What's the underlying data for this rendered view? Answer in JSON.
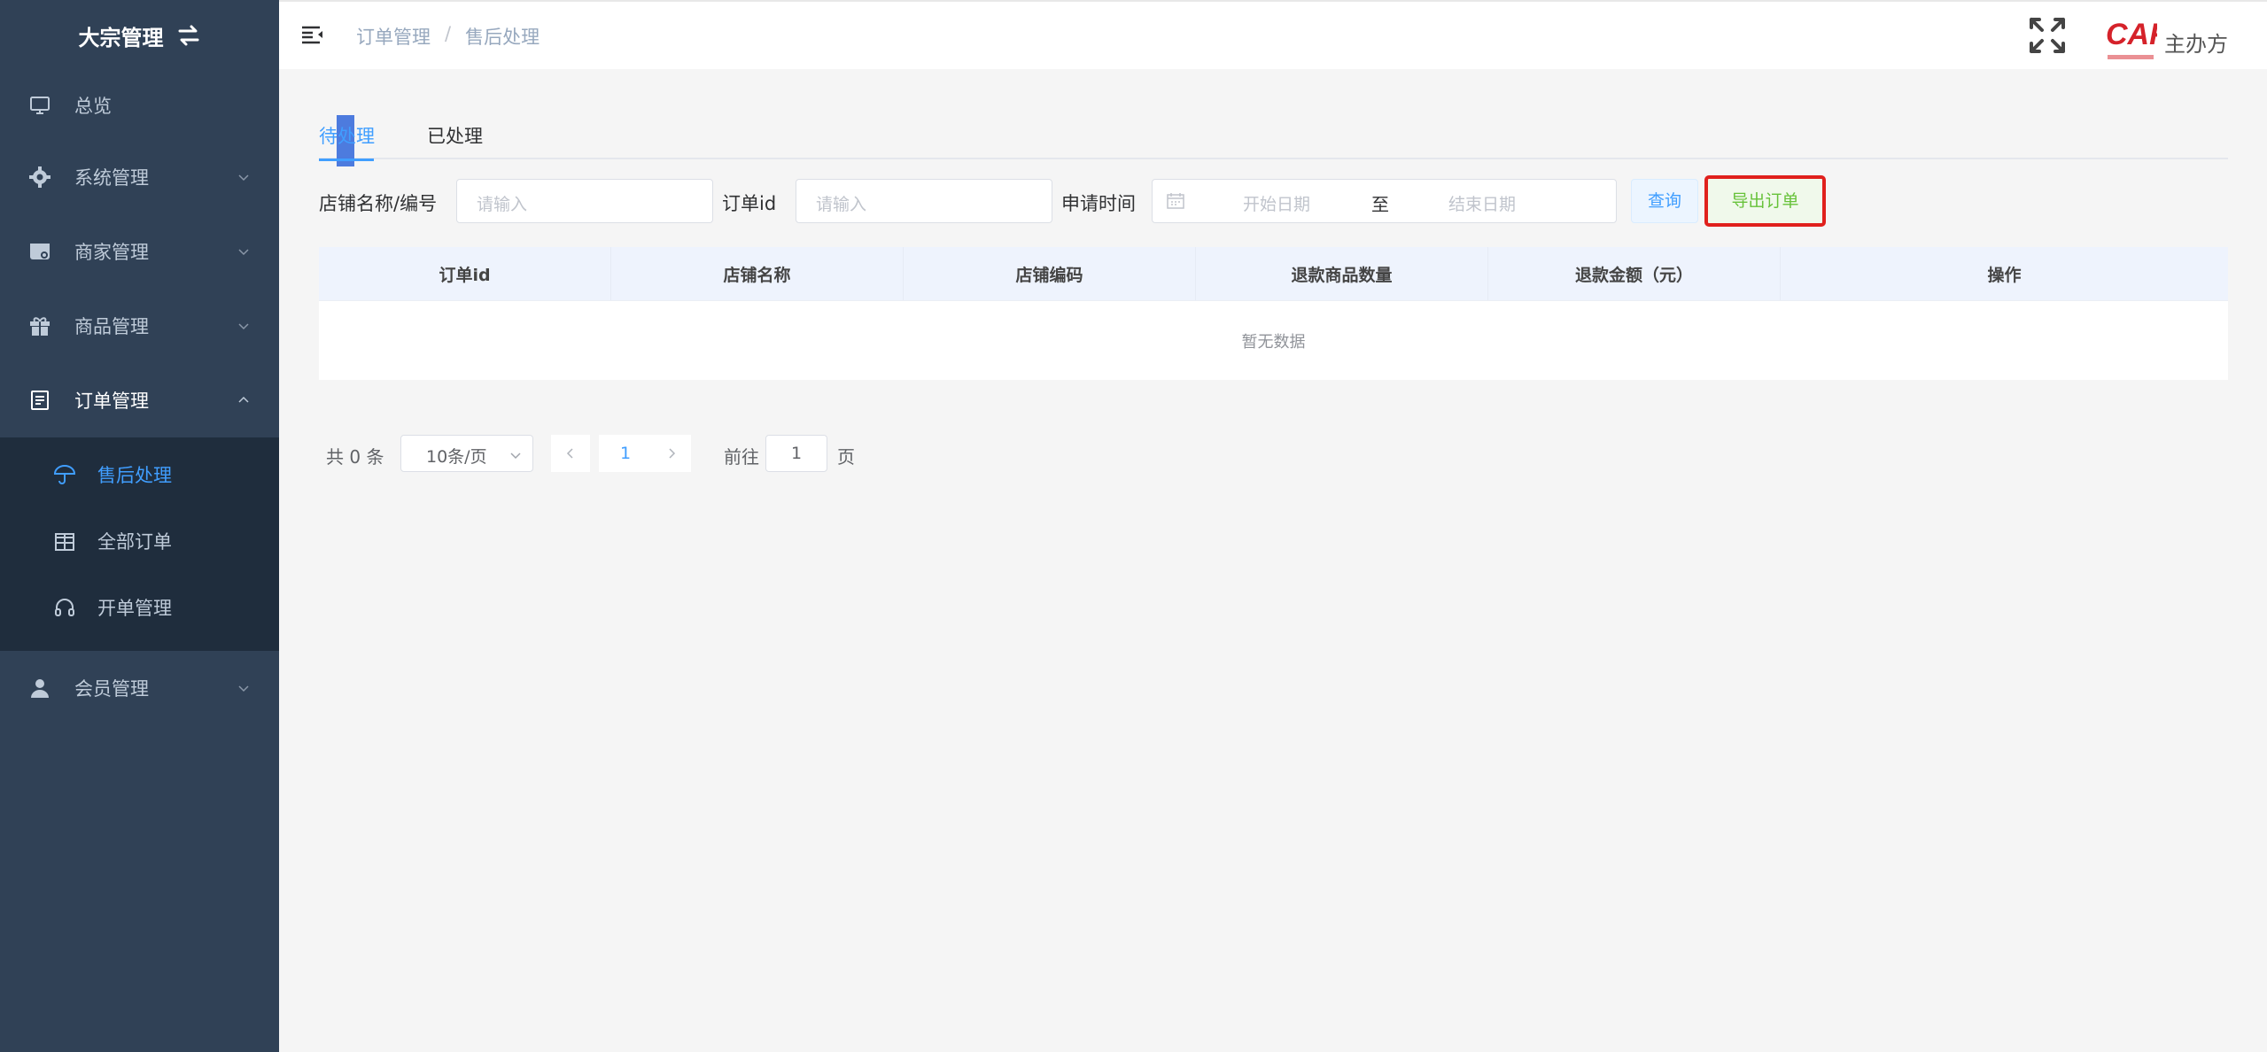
{
  "sidebar": {
    "brand": "大宗管理",
    "items": [
      {
        "label": "总览",
        "icon": "monitor-icon"
      },
      {
        "label": "系统管理",
        "icon": "gear-icon"
      },
      {
        "label": "商家管理",
        "icon": "store-icon"
      },
      {
        "label": "商品管理",
        "icon": "gift-icon"
      },
      {
        "label": "订单管理",
        "icon": "document-icon"
      },
      {
        "label": "会员管理",
        "icon": "user-icon"
      }
    ],
    "order_submenu": [
      {
        "label": "售后处理",
        "icon": "umbrella-icon",
        "active": true
      },
      {
        "label": "全部订单",
        "icon": "package-icon"
      },
      {
        "label": "开单管理",
        "icon": "headset-icon"
      }
    ]
  },
  "header": {
    "breadcrumb": [
      "订单管理",
      "售后处理"
    ],
    "breadcrumb_sep": "/",
    "organizer": "主办方"
  },
  "tabs": [
    {
      "label": "待处理",
      "active": true
    },
    {
      "label": "已处理",
      "active": false
    }
  ],
  "filters": {
    "store_label": "店铺名称/编号",
    "store_placeholder": "请输入",
    "order_label": "订单id",
    "order_placeholder": "请输入",
    "time_label": "申请时间",
    "start_placeholder": "开始日期",
    "range_sep": "至",
    "end_placeholder": "结束日期",
    "query_button": "查询",
    "export_button": "导出订单"
  },
  "table": {
    "columns": [
      "订单id",
      "店铺名称",
      "店铺编码",
      "退款商品数量",
      "退款金额（元）",
      "操作"
    ],
    "empty_text": "暂无数据"
  },
  "pagination": {
    "total_text": "共 0 条",
    "page_size": "10条/页",
    "current_page": "1",
    "goto_label": "前往",
    "goto_value": "1",
    "page_suffix": "页"
  },
  "colors": {
    "sidebar_bg": "#304156",
    "submenu_bg": "#1f2d3d",
    "accent": "#409eff",
    "export_border": "#e0201d",
    "export_text": "#67c23a"
  }
}
